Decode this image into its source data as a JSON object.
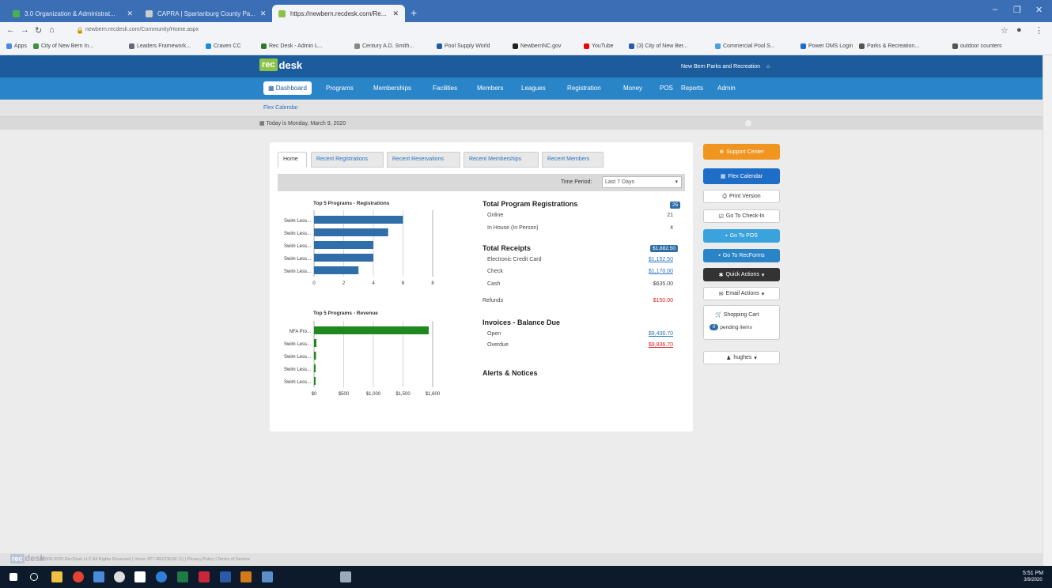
{
  "browser": {
    "tabs": [
      {
        "title": "3.0 Organization & Administrat...",
        "active": false
      },
      {
        "title": "CAPRA | Spartanburg County Pa...",
        "active": false
      },
      {
        "title": "https://newbern.recdesk.com/Re...",
        "active": true
      }
    ],
    "new_tab_label": "+",
    "url": "newbern.recdesk.com/Community/Home.aspx",
    "bookmarks": [
      "Apps",
      "City of New Bern In...",
      "Leaders Framework...",
      "Craven CC",
      "Rec Desk - Admin L...",
      "Century A.D. Smith...",
      "Pool Supply World",
      "NewbernNC.gov",
      "YouTube",
      "(3) City of New Ber...",
      "Commercial Pool S...",
      "Power DMS Login",
      "Parks & Recreation...",
      "outdoor counters"
    ],
    "window_controls": [
      "–",
      "❐",
      "✕"
    ]
  },
  "header": {
    "logo_rec": "rec",
    "logo_desk": "desk",
    "org_name": "New Bern Parks and Recreation"
  },
  "nav": {
    "items": [
      "Dashboard",
      "Programs",
      "Memberships",
      "Facilities",
      "Members",
      "Leagues",
      "Registration",
      "Money",
      "POS",
      "Reports",
      "Admin"
    ]
  },
  "subnav": {
    "link": "Flex Calendar"
  },
  "datebar": {
    "date": "Today is Monday, March 9, 2020",
    "dashboard": "Dashboard"
  },
  "panel": {
    "tabs": [
      "Home",
      "Recent Registrations",
      "Recent Reservations",
      "Recent Memberships",
      "Recent Members"
    ],
    "time_period_label": "Time Period:",
    "time_period_value": "Last 7 Days"
  },
  "chart_data": [
    {
      "type": "bar",
      "title": "Top 5 Programs - Registrations",
      "categories": [
        "Swim Less...",
        "Swim Less...",
        "Swim Less...",
        "Swim Less...",
        "Swim Less..."
      ],
      "values": [
        6,
        5,
        4,
        4,
        3
      ],
      "xlim": [
        0,
        8
      ],
      "xticks": [
        "0",
        "2",
        "4",
        "6",
        "8"
      ]
    },
    {
      "type": "bar",
      "title": "Top 5 Programs - Revenue",
      "categories": [
        "NFA Pro...",
        "Swim Less...",
        "Swim Less...",
        "Swim Less...",
        "Swim Less..."
      ],
      "values": [
        1450,
        30,
        25,
        20,
        20
      ],
      "xlim": [
        0,
        1500
      ],
      "xticks": [
        "$0",
        "$500",
        "$1,000",
        "$1,500",
        "$1,600"
      ]
    }
  ],
  "stats": {
    "total_reg_title": "Total Program Registrations",
    "total_reg_badge": "25",
    "online_label": "Online",
    "online_value": "21",
    "inhouse_label": "In House (In Person)",
    "inhouse_value": "4",
    "receipts_title": "Total Receipts",
    "receipts_badge": "$1,882.50",
    "credit_label": "Electronic Credit Card",
    "credit_value": "$1,152.50",
    "check_label": "Check",
    "check_value": "$1,170.00",
    "cash_label": "Cash",
    "cash_value": "$635.00",
    "refunds_label": "Refunds",
    "refunds_value": "$150.00",
    "invoices_title": "Invoices - Balance Due",
    "open_label": "Open",
    "open_value": "$9,436.70",
    "overdue_label": "Overdue",
    "overdue_value": "$9,836.70",
    "alerts_title": "Alerts & Notices"
  },
  "right": {
    "support": "Support Center",
    "flex_calendar": "Flex Calendar",
    "print_version": "Print Version",
    "go_checkin": "Go To Check-In",
    "go_pos": "Go To POS",
    "go_recforms": "Go To RecForms",
    "quick_actions": "Quick Actions",
    "email_actions": "Email Actions",
    "cart_title": "Shopping Cart",
    "cart_count": "0",
    "cart_pending": "pending items",
    "user": "hughes"
  },
  "footer": {
    "text": "©2008-2020 RecDesk LLC All Rights Reserved | Voice: 877-RECDESK (1) | Privacy Policy | Terms of Service"
  },
  "taskbar": {
    "time": "5:51 PM",
    "date": "3/9/2020"
  }
}
